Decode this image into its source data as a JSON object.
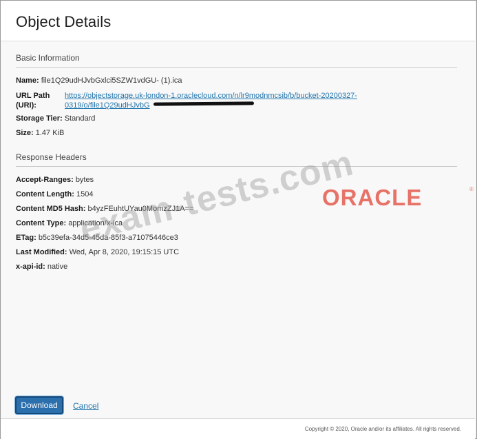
{
  "dialog": {
    "title": "Object Details"
  },
  "basic_info": {
    "heading": "Basic Information",
    "name_label": "Name:",
    "name_value": "file1Q29udHJvbGxlci5SZW1vdGU- (1).ica",
    "url_label_line1": "URL Path",
    "url_label_line2": "(URI):",
    "url_line1": "https://objectstorage.uk-london-1.oraclecloud.com/n/lr9modnmcsib/b/bucket-20200327-",
    "url_line2": "0319/o/file1Q29udHJvbG",
    "storage_tier_label": "Storage Tier:",
    "storage_tier_value": "Standard",
    "size_label": "Size:",
    "size_value": "1.47 KiB"
  },
  "response_headers": {
    "heading": "Response Headers",
    "items": [
      {
        "label": "Accept-Ranges:",
        "value": "bytes"
      },
      {
        "label": "Content Length:",
        "value": "1504"
      },
      {
        "label": "Content MD5 Hash:",
        "value": "b4yzFEuhtUYau0MomzZJ1A=="
      },
      {
        "label": "Content Type:",
        "value": "application/x-ica"
      },
      {
        "label": "ETag:",
        "value": "b5c39efa-34d5-45da-85f3-a71075446ce3"
      },
      {
        "label": "Last Modified:",
        "value": "Wed, Apr 8, 2020, 19:15:15 UTC"
      },
      {
        "label": "x-api-id:",
        "value": "native"
      }
    ]
  },
  "actions": {
    "download_label": "Download",
    "cancel_label": "Cancel"
  },
  "footer": {
    "copyright": "Copyright © 2020, Oracle and/or its affiliates. All rights reserved."
  },
  "overlay": {
    "watermark_text": "exam-tests.com",
    "logo_text": "ORACLE",
    "registered_mark": "®"
  },
  "colors": {
    "primary_button": "#2b6fad",
    "link": "#1f74ad",
    "logo_red": "#e24637"
  }
}
